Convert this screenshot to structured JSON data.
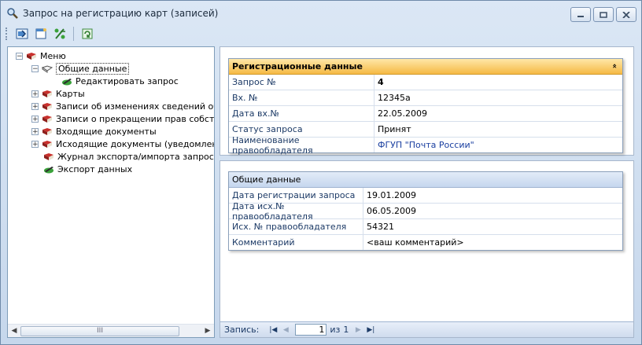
{
  "window": {
    "title": "Запрос на регистрацию карт (записей)"
  },
  "toolbar": {
    "buttons": [
      {
        "icon": "save-form-icon"
      },
      {
        "icon": "new-document-icon"
      },
      {
        "icon": "percent-icon"
      },
      {
        "icon": "refresh-icon"
      }
    ]
  },
  "tree": {
    "nodes": [
      {
        "label": "Меню",
        "expander": "−",
        "icon": "book-icon"
      },
      {
        "label": "Общие данные",
        "expander": "−",
        "icon": "open-book-icon"
      },
      {
        "label": "Редактировать запрос",
        "expander": "",
        "icon": "edit-pencil-icon"
      },
      {
        "label": "Карты",
        "expander": "+",
        "icon": "book-icon"
      },
      {
        "label": "Записи об изменениях сведений об об",
        "expander": "+",
        "icon": "book-icon"
      },
      {
        "label": "Записи о прекращении прав собствен",
        "expander": "+",
        "icon": "book-icon"
      },
      {
        "label": "Входящие документы",
        "expander": "+",
        "icon": "book-icon"
      },
      {
        "label": "Исходящие документы (уведомления,",
        "expander": "+",
        "icon": "book-icon"
      },
      {
        "label": "Журнал экспорта/импорта запроса",
        "expander": "",
        "icon": "book-icon"
      },
      {
        "label": "Экспорт данных",
        "expander": "",
        "icon": "edit-pencil-icon"
      }
    ],
    "scroll_thumb_glyph": "III"
  },
  "registration": {
    "header": "Регистрационные данные",
    "collapse_glyph": "»",
    "rows": [
      {
        "label": "Запрос №",
        "value": "4"
      },
      {
        "label": "Вх. №",
        "value": "12345а"
      },
      {
        "label": "Дата вх.№",
        "value": "22.05.2009"
      },
      {
        "label": "Статус запроса",
        "value": "Принят"
      },
      {
        "label": "Наименование правообладателя",
        "value": "ФГУП \"Почта России\""
      }
    ]
  },
  "general": {
    "header": "Общие данные",
    "rows": [
      {
        "label": "Дата регистрации запроса",
        "value": "19.01.2009"
      },
      {
        "label": "Дата исх.№ правообладателя",
        "value": "06.05.2009"
      },
      {
        "label": "Исх. № правообладателя",
        "value": "54321"
      },
      {
        "label": "Комментарий",
        "value": "<ваш комментарий>"
      }
    ]
  },
  "navigator": {
    "label": "Запись:",
    "current": "1",
    "of_label": "из",
    "total": "1"
  },
  "colors": {
    "header_orange": "#f5b944",
    "header_blue": "#c5d6ee",
    "label_text": "#1c3a66"
  }
}
